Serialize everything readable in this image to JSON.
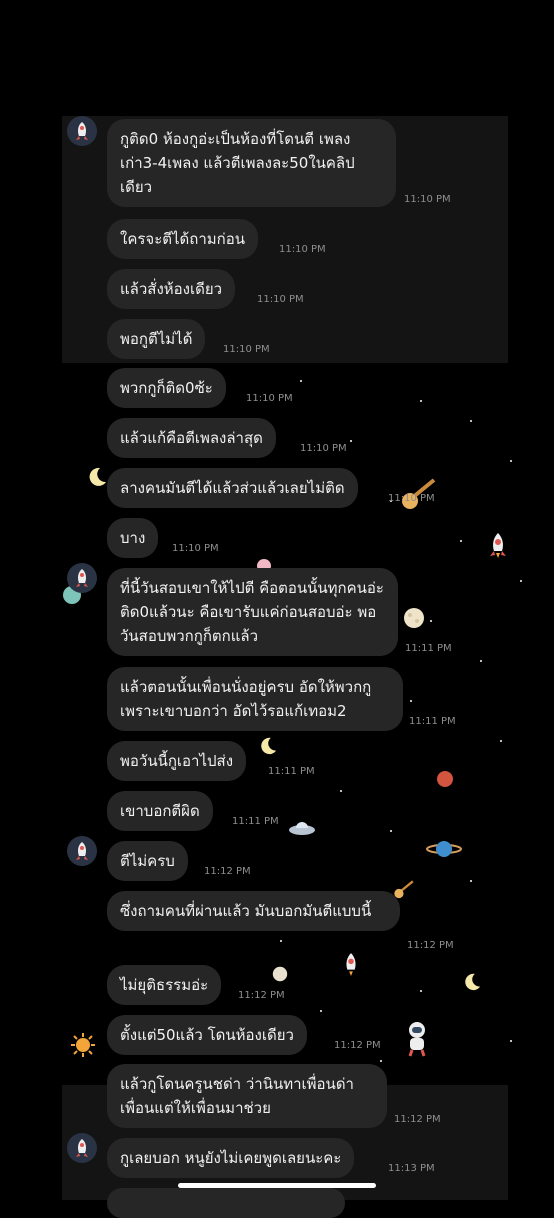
{
  "messages": [
    {
      "text": "กูติด0 ห้องกูอ่ะเป็นห้องที่โดนตี เพลงเก่า3-4เพลง แล้วตีเพลงละ50ในคลิปเดียว",
      "time": "11:10 PM"
    },
    {
      "text": "ใครจะตีได้ถามก่อน",
      "time": "11:10 PM"
    },
    {
      "text": "แล้วสั่งห้องเดียว",
      "time": "11:10 PM"
    },
    {
      "text": "พอกูตีไม่ได้",
      "time": "11:10 PM"
    },
    {
      "text": "พวกกูก็ติด0ซ้ะ",
      "time": "11:10 PM"
    },
    {
      "text": "แล้วแก้คือตีเพลงล่าสุด",
      "time": "11:10 PM"
    },
    {
      "text": "ลางคนมันตีได้แล้วส่วแล้วเลยไม่ติด",
      "time": "11:10 PM"
    },
    {
      "text": "บาง",
      "time": "11:10 PM"
    },
    {
      "text": "ที่นี้วันสอบเขาให้ไปตี คือตอนนั้นทุกคนอ่ะติด0แล้วนะ คือเขารับแค่ก่อนสอบอ่ะ พอวันสอบพวกกูก็ตกแล้ว",
      "time": "11:11 PM"
    },
    {
      "text": "แล้วตอนนั้นเพื่อนนั่งอยู่ครบ อัดให้พวกกูเพราะเขาบอกว่า อัดไว้รอแก้เทอม2",
      "time": "11:11 PM"
    },
    {
      "text": "พอวันนี้กูเอาไปส่ง",
      "time": "11:11 PM"
    },
    {
      "text": "เขาบอกตีผิด",
      "time": "11:11 PM"
    },
    {
      "text": "ตีไม่ครบ",
      "time": "11:12 PM"
    },
    {
      "text": "ซึ่งถามคนที่ผ่านแล้ว มันบอกมันตีแบบนี้",
      "time": "11:12 PM"
    },
    {
      "text": "ไม่ยุติธรรมอ่ะ",
      "time": "11:12 PM"
    },
    {
      "text": "ตั้งแต่50แล้ว โดนห้องเดียว",
      "time": "11:12 PM"
    },
    {
      "text": "แล้วกูโดนครูนชด่า ว่านินทาเพื่อนด่าเพื่อนแต่ให้เพื่อนมาช่วย",
      "time": "11:12 PM"
    },
    {
      "text": "กูเลยบอก หนูยังไม่เคยพูดเลยนะคะ",
      "time": "11:13 PM"
    }
  ],
  "icons": {
    "avatar": "rocket-icon",
    "stickers": [
      "moon-icon",
      "rocket-icon",
      "planet-icon",
      "ufo-icon",
      "comet-icon",
      "astronaut-icon",
      "sun-icon"
    ]
  },
  "colors": {
    "background": "#000000",
    "bubble": "#262626",
    "text": "#f2f2f2",
    "timestamp": "#8e8e8e"
  }
}
